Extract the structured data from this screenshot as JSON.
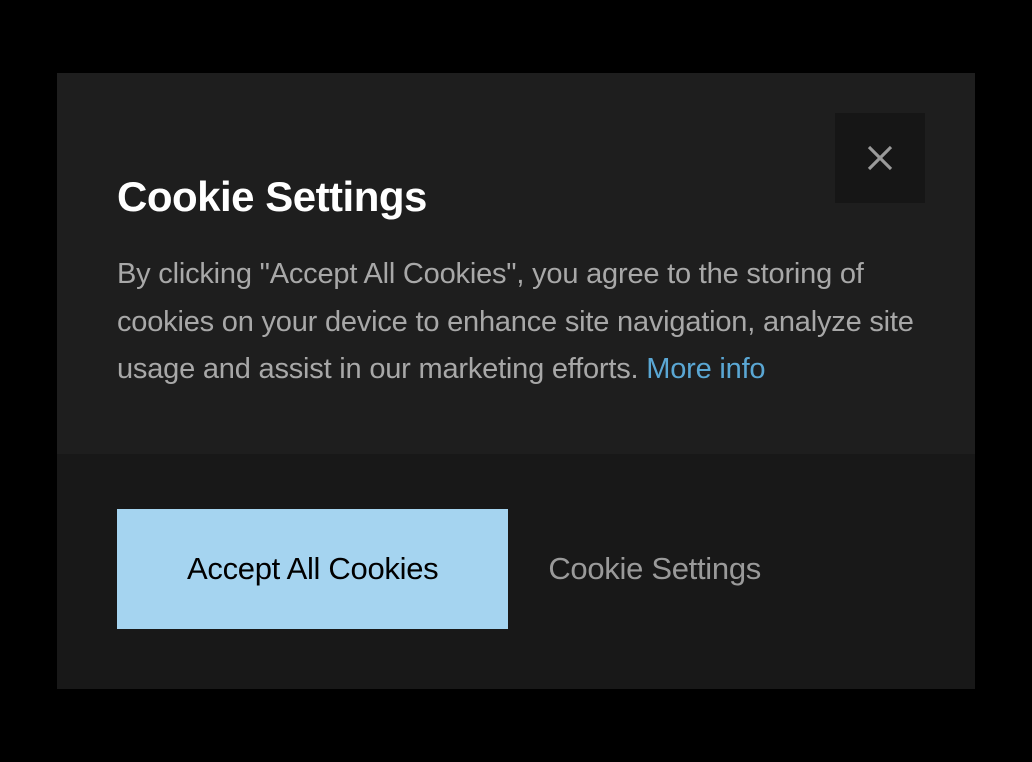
{
  "modal": {
    "title": "Cookie Settings",
    "description": "By clicking \"Accept All Cookies\", you agree to the storing of cookies on your device to enhance site navigation, analyze site usage and assist in our marketing efforts. ",
    "more_info_label": "More info",
    "accept_button_label": "Accept All Cookies",
    "settings_button_label": "Cookie Settings"
  }
}
